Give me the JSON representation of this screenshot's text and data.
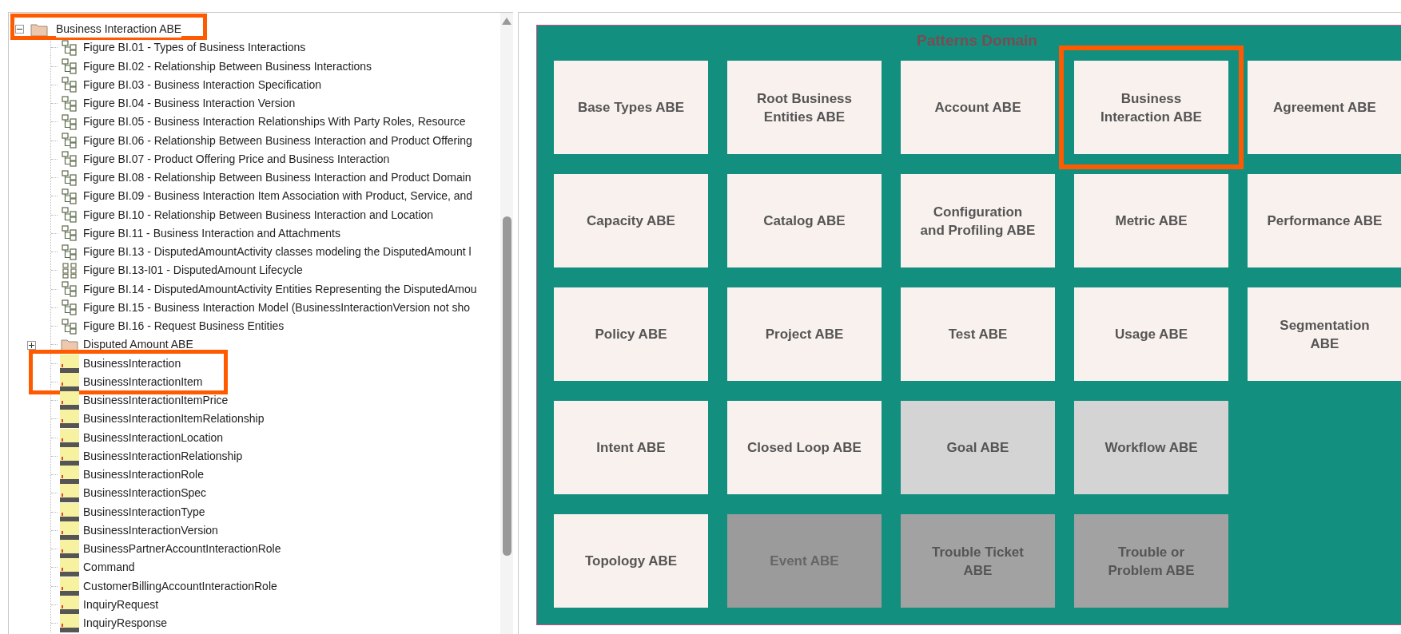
{
  "tree": {
    "root": {
      "label": "Business Interaction ABE",
      "kind": "folder",
      "expanded": true,
      "highlighted": true,
      "children": [
        {
          "label": "Figure BI.01 - Types of Business Interactions",
          "kind": "diagram",
          "highlighted": false
        },
        {
          "label": "Figure BI.02 - Relationship Between Business Interactions",
          "kind": "diagram",
          "highlighted": false
        },
        {
          "label": "Figure BI.03 - Business Interaction Specification",
          "kind": "diagram",
          "highlighted": false
        },
        {
          "label": "Figure BI.04 - Business Interaction Version",
          "kind": "diagram",
          "highlighted": false
        },
        {
          "label": "Figure BI.05 - Business Interaction Relationships With Party Roles, Resource",
          "kind": "diagram",
          "highlighted": false
        },
        {
          "label": "Figure BI.06 - Relationship Between Business Interaction and Product Offering",
          "kind": "diagram",
          "highlighted": false
        },
        {
          "label": "Figure BI.07 - Product Offering Price and Business Interaction",
          "kind": "diagram",
          "highlighted": false
        },
        {
          "label": "Figure BI.08 - Relationship Between Business Interaction and Product Domain",
          "kind": "diagram",
          "highlighted": false
        },
        {
          "label": "Figure BI.09 - Business Interaction Item Association with Product, Service, and",
          "kind": "diagram",
          "highlighted": false
        },
        {
          "label": "Figure BI.10 - Relationship Between Business Interaction and Location",
          "kind": "diagram",
          "highlighted": false
        },
        {
          "label": "Figure BI.11 - Business Interaction and Attachments",
          "kind": "diagram",
          "highlighted": false
        },
        {
          "label": "Figure BI.13 - DisputedAmountActivity classes modeling the DisputedAmount l",
          "kind": "diagram",
          "highlighted": false
        },
        {
          "label": "Figure BI.13-I01 - DisputedAmount Lifecycle",
          "kind": "grid-diagram",
          "highlighted": false
        },
        {
          "label": "Figure BI.14 - DisputedAmountActivity Entities Representing the DisputedAmou",
          "kind": "diagram",
          "highlighted": false
        },
        {
          "label": "Figure BI.15 - Business Interaction Model (BusinessInteractionVersion not sho",
          "kind": "diagram",
          "highlighted": false
        },
        {
          "label": "Figure BI.16 - Request Business Entities",
          "kind": "diagram",
          "highlighted": false
        },
        {
          "label": "Disputed Amount ABE",
          "kind": "folder",
          "expanded": false,
          "highlighted": false
        },
        {
          "label": "BusinessInteraction",
          "kind": "class",
          "highlighted": true
        },
        {
          "label": "BusinessInteractionItem",
          "kind": "class",
          "highlighted": true
        },
        {
          "label": "BusinessInteractionItemPrice",
          "kind": "class",
          "highlighted": false
        },
        {
          "label": "BusinessInteractionItemRelationship",
          "kind": "class",
          "highlighted": false
        },
        {
          "label": "BusinessInteractionLocation",
          "kind": "class",
          "highlighted": false
        },
        {
          "label": "BusinessInteractionRelationship",
          "kind": "class",
          "highlighted": false
        },
        {
          "label": "BusinessInteractionRole",
          "kind": "class",
          "highlighted": false
        },
        {
          "label": "BusinessInteractionSpec",
          "kind": "class",
          "highlighted": false
        },
        {
          "label": "BusinessInteractionType",
          "kind": "class",
          "highlighted": false
        },
        {
          "label": "BusinessInteractionVersion",
          "kind": "class",
          "highlighted": false
        },
        {
          "label": "BusinessPartnerAccountInteractionRole",
          "kind": "class",
          "highlighted": false
        },
        {
          "label": "Command",
          "kind": "class",
          "highlighted": false
        },
        {
          "label": "CustomerBillingAccountInteractionRole",
          "kind": "class",
          "highlighted": false
        },
        {
          "label": "InquiryRequest",
          "kind": "class",
          "highlighted": false
        },
        {
          "label": "InquiryResponse",
          "kind": "class",
          "highlighted": false
        }
      ]
    }
  },
  "domain": {
    "title": "Patterns Domain",
    "rows": [
      [
        {
          "label": "Base Types ABE",
          "kind": "normal",
          "highlighted": false
        },
        {
          "label": "Root Business\nEntities ABE",
          "kind": "normal",
          "highlighted": false
        },
        {
          "label": "Account ABE",
          "kind": "normal",
          "highlighted": false
        },
        {
          "label": "Business\nInteraction ABE",
          "kind": "normal",
          "highlighted": true
        },
        {
          "label": "Agreement ABE",
          "kind": "normal",
          "highlighted": false
        }
      ],
      [
        {
          "label": "Capacity ABE",
          "kind": "normal",
          "highlighted": false
        },
        {
          "label": "Catalog ABE",
          "kind": "normal",
          "highlighted": false
        },
        {
          "label": "Configuration\nand Profiling ABE",
          "kind": "normal",
          "highlighted": false
        },
        {
          "label": "Metric ABE",
          "kind": "normal",
          "highlighted": false
        },
        {
          "label": "Performance ABE",
          "kind": "normal",
          "highlighted": false
        }
      ],
      [
        {
          "label": "Policy ABE",
          "kind": "normal",
          "highlighted": false
        },
        {
          "label": "Project ABE",
          "kind": "normal",
          "highlighted": false
        },
        {
          "label": "Test ABE",
          "kind": "normal",
          "highlighted": false
        },
        {
          "label": "Usage ABE",
          "kind": "normal",
          "highlighted": false
        },
        {
          "label": "Segmentation\nABE",
          "kind": "normal",
          "highlighted": false
        }
      ],
      [
        {
          "label": "Intent ABE",
          "kind": "normal",
          "highlighted": false
        },
        {
          "label": "Closed Loop ABE",
          "kind": "normal",
          "highlighted": false
        },
        {
          "label": "Goal ABE",
          "kind": "light",
          "highlighted": false
        },
        {
          "label": "Workflow ABE",
          "kind": "light",
          "highlighted": false
        }
      ],
      [
        {
          "label": "Topology ABE",
          "kind": "normal",
          "highlighted": false
        },
        {
          "label": "Event ABE",
          "kind": "dark",
          "highlighted": false
        },
        {
          "label": "Trouble Ticket\nABE",
          "kind": "medium",
          "highlighted": false
        },
        {
          "label": "Trouble or\nProblem ABE",
          "kind": "medium",
          "highlighted": false
        }
      ]
    ]
  }
}
